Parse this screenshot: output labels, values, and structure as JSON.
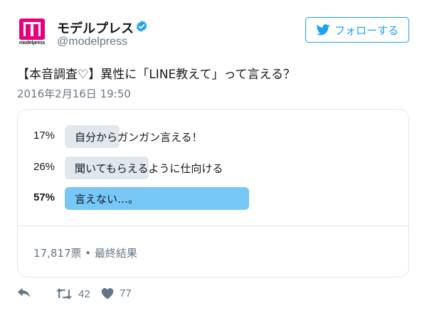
{
  "account": {
    "name": "モデルプレス",
    "handle": "@modelpress",
    "logo_text": "modelpress",
    "verified": true,
    "avatar_color": "#e4007f"
  },
  "follow_button": {
    "label": "フォローする",
    "icon": "twitter-bird-icon",
    "color": "#1da1f2"
  },
  "tweet": {
    "text": "【本音調査♡】異性に「LINE教えて」って言える？",
    "timestamp": "2016年2月16日  19:50"
  },
  "poll": {
    "options": [
      {
        "percent": "17%",
        "label": "自分からガンガン言える！",
        "value": 0.17,
        "winner": false
      },
      {
        "percent": "26%",
        "label": "聞いてもらえるように仕向ける",
        "value": 0.26,
        "winner": false
      },
      {
        "percent": "57%",
        "label": "言えない…。",
        "value": 0.57,
        "winner": true
      }
    ],
    "footer": "17,817票 • 最終結果",
    "bar_color": "#e1e8ed",
    "winner_color": "#77c7f7"
  },
  "actions": {
    "reply_icon": "reply-icon",
    "retweet_icon": "retweet-icon",
    "retweet_count": "42",
    "like_icon": "heart-icon",
    "like_count": "77"
  }
}
